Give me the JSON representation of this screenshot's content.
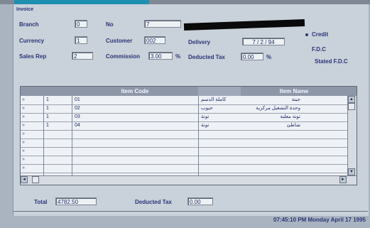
{
  "window": {
    "title": "Invoice"
  },
  "header": {
    "branch_label": "Branch",
    "branch_value": "0",
    "no_label": "No",
    "no_value": "7",
    "currency_label": "Currency",
    "currency_value": "1",
    "customer_label": "Customer",
    "customer_value": "002",
    "delivery_label": "Delivery",
    "delivery_value": "7 / 2 / 94",
    "salesrep_label": "Sales Rep",
    "salesrep_value": "2",
    "commission_label": "Commission",
    "commission_value": "3.00",
    "commission_unit": "%",
    "deducted_label": "Deducted Tax",
    "deducted_value": "0.00",
    "deducted_unit": "%"
  },
  "payment": {
    "credit_label": "Credit",
    "fdc_label": "F.D.C",
    "stated_label": "Stated F.D.C"
  },
  "grid": {
    "columns": [
      "",
      "",
      "Item Code",
      "",
      "Item Name"
    ],
    "rows": [
      {
        "a": "1",
        "b": "01",
        "name": "جبنة",
        "tag": "كاملة الدسم"
      },
      {
        "a": "1",
        "b": "02",
        "name": "وحدة التشغيل مركزية",
        "tag": "حبوب"
      },
      {
        "a": "1",
        "b": "03",
        "name": "تونة معلبة",
        "tag": "تونة"
      },
      {
        "a": "1",
        "b": "04",
        "name": "شاطئ",
        "tag": "تونة"
      },
      {
        "a": "",
        "b": "",
        "name": "",
        "tag": ""
      },
      {
        "a": "",
        "b": "",
        "name": "",
        "tag": ""
      },
      {
        "a": "",
        "b": "",
        "name": "",
        "tag": ""
      },
      {
        "a": "",
        "b": "",
        "name": "",
        "tag": ""
      },
      {
        "a": "",
        "b": "",
        "name": "",
        "tag": ""
      }
    ]
  },
  "totals": {
    "total_label": "Total",
    "total_value": "4782.50",
    "deducted_label": "Deducted Tax",
    "deducted_value": "0.00"
  },
  "statusbar": {
    "text": "07:45:10 PM  Monday April 17  1995"
  }
}
